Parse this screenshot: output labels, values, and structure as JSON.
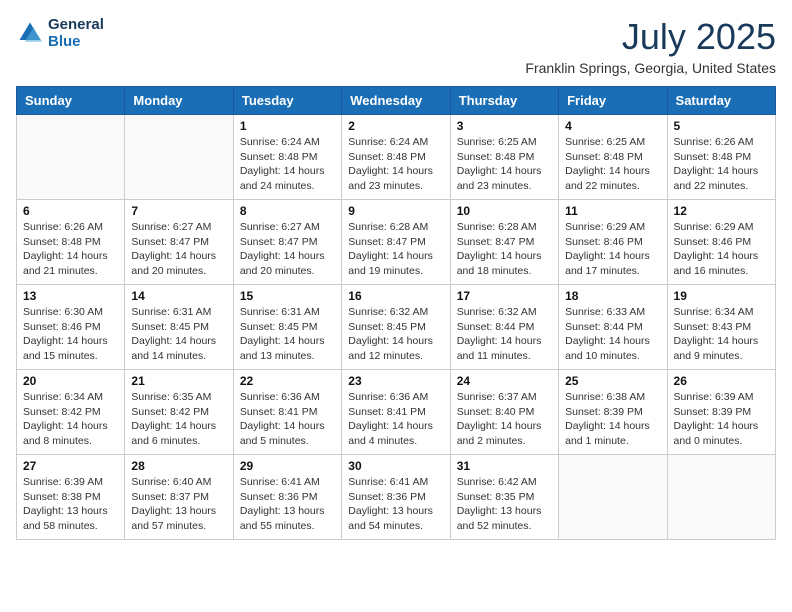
{
  "header": {
    "logo_line1": "General",
    "logo_line2": "Blue",
    "month": "July 2025",
    "location": "Franklin Springs, Georgia, United States"
  },
  "weekdays": [
    "Sunday",
    "Monday",
    "Tuesday",
    "Wednesday",
    "Thursday",
    "Friday",
    "Saturday"
  ],
  "weeks": [
    [
      {
        "day": "",
        "info": ""
      },
      {
        "day": "",
        "info": ""
      },
      {
        "day": "1",
        "info": "Sunrise: 6:24 AM\nSunset: 8:48 PM\nDaylight: 14 hours and 24 minutes."
      },
      {
        "day": "2",
        "info": "Sunrise: 6:24 AM\nSunset: 8:48 PM\nDaylight: 14 hours and 23 minutes."
      },
      {
        "day": "3",
        "info": "Sunrise: 6:25 AM\nSunset: 8:48 PM\nDaylight: 14 hours and 23 minutes."
      },
      {
        "day": "4",
        "info": "Sunrise: 6:25 AM\nSunset: 8:48 PM\nDaylight: 14 hours and 22 minutes."
      },
      {
        "day": "5",
        "info": "Sunrise: 6:26 AM\nSunset: 8:48 PM\nDaylight: 14 hours and 22 minutes."
      }
    ],
    [
      {
        "day": "6",
        "info": "Sunrise: 6:26 AM\nSunset: 8:48 PM\nDaylight: 14 hours and 21 minutes."
      },
      {
        "day": "7",
        "info": "Sunrise: 6:27 AM\nSunset: 8:47 PM\nDaylight: 14 hours and 20 minutes."
      },
      {
        "day": "8",
        "info": "Sunrise: 6:27 AM\nSunset: 8:47 PM\nDaylight: 14 hours and 20 minutes."
      },
      {
        "day": "9",
        "info": "Sunrise: 6:28 AM\nSunset: 8:47 PM\nDaylight: 14 hours and 19 minutes."
      },
      {
        "day": "10",
        "info": "Sunrise: 6:28 AM\nSunset: 8:47 PM\nDaylight: 14 hours and 18 minutes."
      },
      {
        "day": "11",
        "info": "Sunrise: 6:29 AM\nSunset: 8:46 PM\nDaylight: 14 hours and 17 minutes."
      },
      {
        "day": "12",
        "info": "Sunrise: 6:29 AM\nSunset: 8:46 PM\nDaylight: 14 hours and 16 minutes."
      }
    ],
    [
      {
        "day": "13",
        "info": "Sunrise: 6:30 AM\nSunset: 8:46 PM\nDaylight: 14 hours and 15 minutes."
      },
      {
        "day": "14",
        "info": "Sunrise: 6:31 AM\nSunset: 8:45 PM\nDaylight: 14 hours and 14 minutes."
      },
      {
        "day": "15",
        "info": "Sunrise: 6:31 AM\nSunset: 8:45 PM\nDaylight: 14 hours and 13 minutes."
      },
      {
        "day": "16",
        "info": "Sunrise: 6:32 AM\nSunset: 8:45 PM\nDaylight: 14 hours and 12 minutes."
      },
      {
        "day": "17",
        "info": "Sunrise: 6:32 AM\nSunset: 8:44 PM\nDaylight: 14 hours and 11 minutes."
      },
      {
        "day": "18",
        "info": "Sunrise: 6:33 AM\nSunset: 8:44 PM\nDaylight: 14 hours and 10 minutes."
      },
      {
        "day": "19",
        "info": "Sunrise: 6:34 AM\nSunset: 8:43 PM\nDaylight: 14 hours and 9 minutes."
      }
    ],
    [
      {
        "day": "20",
        "info": "Sunrise: 6:34 AM\nSunset: 8:42 PM\nDaylight: 14 hours and 8 minutes."
      },
      {
        "day": "21",
        "info": "Sunrise: 6:35 AM\nSunset: 8:42 PM\nDaylight: 14 hours and 6 minutes."
      },
      {
        "day": "22",
        "info": "Sunrise: 6:36 AM\nSunset: 8:41 PM\nDaylight: 14 hours and 5 minutes."
      },
      {
        "day": "23",
        "info": "Sunrise: 6:36 AM\nSunset: 8:41 PM\nDaylight: 14 hours and 4 minutes."
      },
      {
        "day": "24",
        "info": "Sunrise: 6:37 AM\nSunset: 8:40 PM\nDaylight: 14 hours and 2 minutes."
      },
      {
        "day": "25",
        "info": "Sunrise: 6:38 AM\nSunset: 8:39 PM\nDaylight: 14 hours and 1 minute."
      },
      {
        "day": "26",
        "info": "Sunrise: 6:39 AM\nSunset: 8:39 PM\nDaylight: 14 hours and 0 minutes."
      }
    ],
    [
      {
        "day": "27",
        "info": "Sunrise: 6:39 AM\nSunset: 8:38 PM\nDaylight: 13 hours and 58 minutes."
      },
      {
        "day": "28",
        "info": "Sunrise: 6:40 AM\nSunset: 8:37 PM\nDaylight: 13 hours and 57 minutes."
      },
      {
        "day": "29",
        "info": "Sunrise: 6:41 AM\nSunset: 8:36 PM\nDaylight: 13 hours and 55 minutes."
      },
      {
        "day": "30",
        "info": "Sunrise: 6:41 AM\nSunset: 8:36 PM\nDaylight: 13 hours and 54 minutes."
      },
      {
        "day": "31",
        "info": "Sunrise: 6:42 AM\nSunset: 8:35 PM\nDaylight: 13 hours and 52 minutes."
      },
      {
        "day": "",
        "info": ""
      },
      {
        "day": "",
        "info": ""
      }
    ]
  ]
}
